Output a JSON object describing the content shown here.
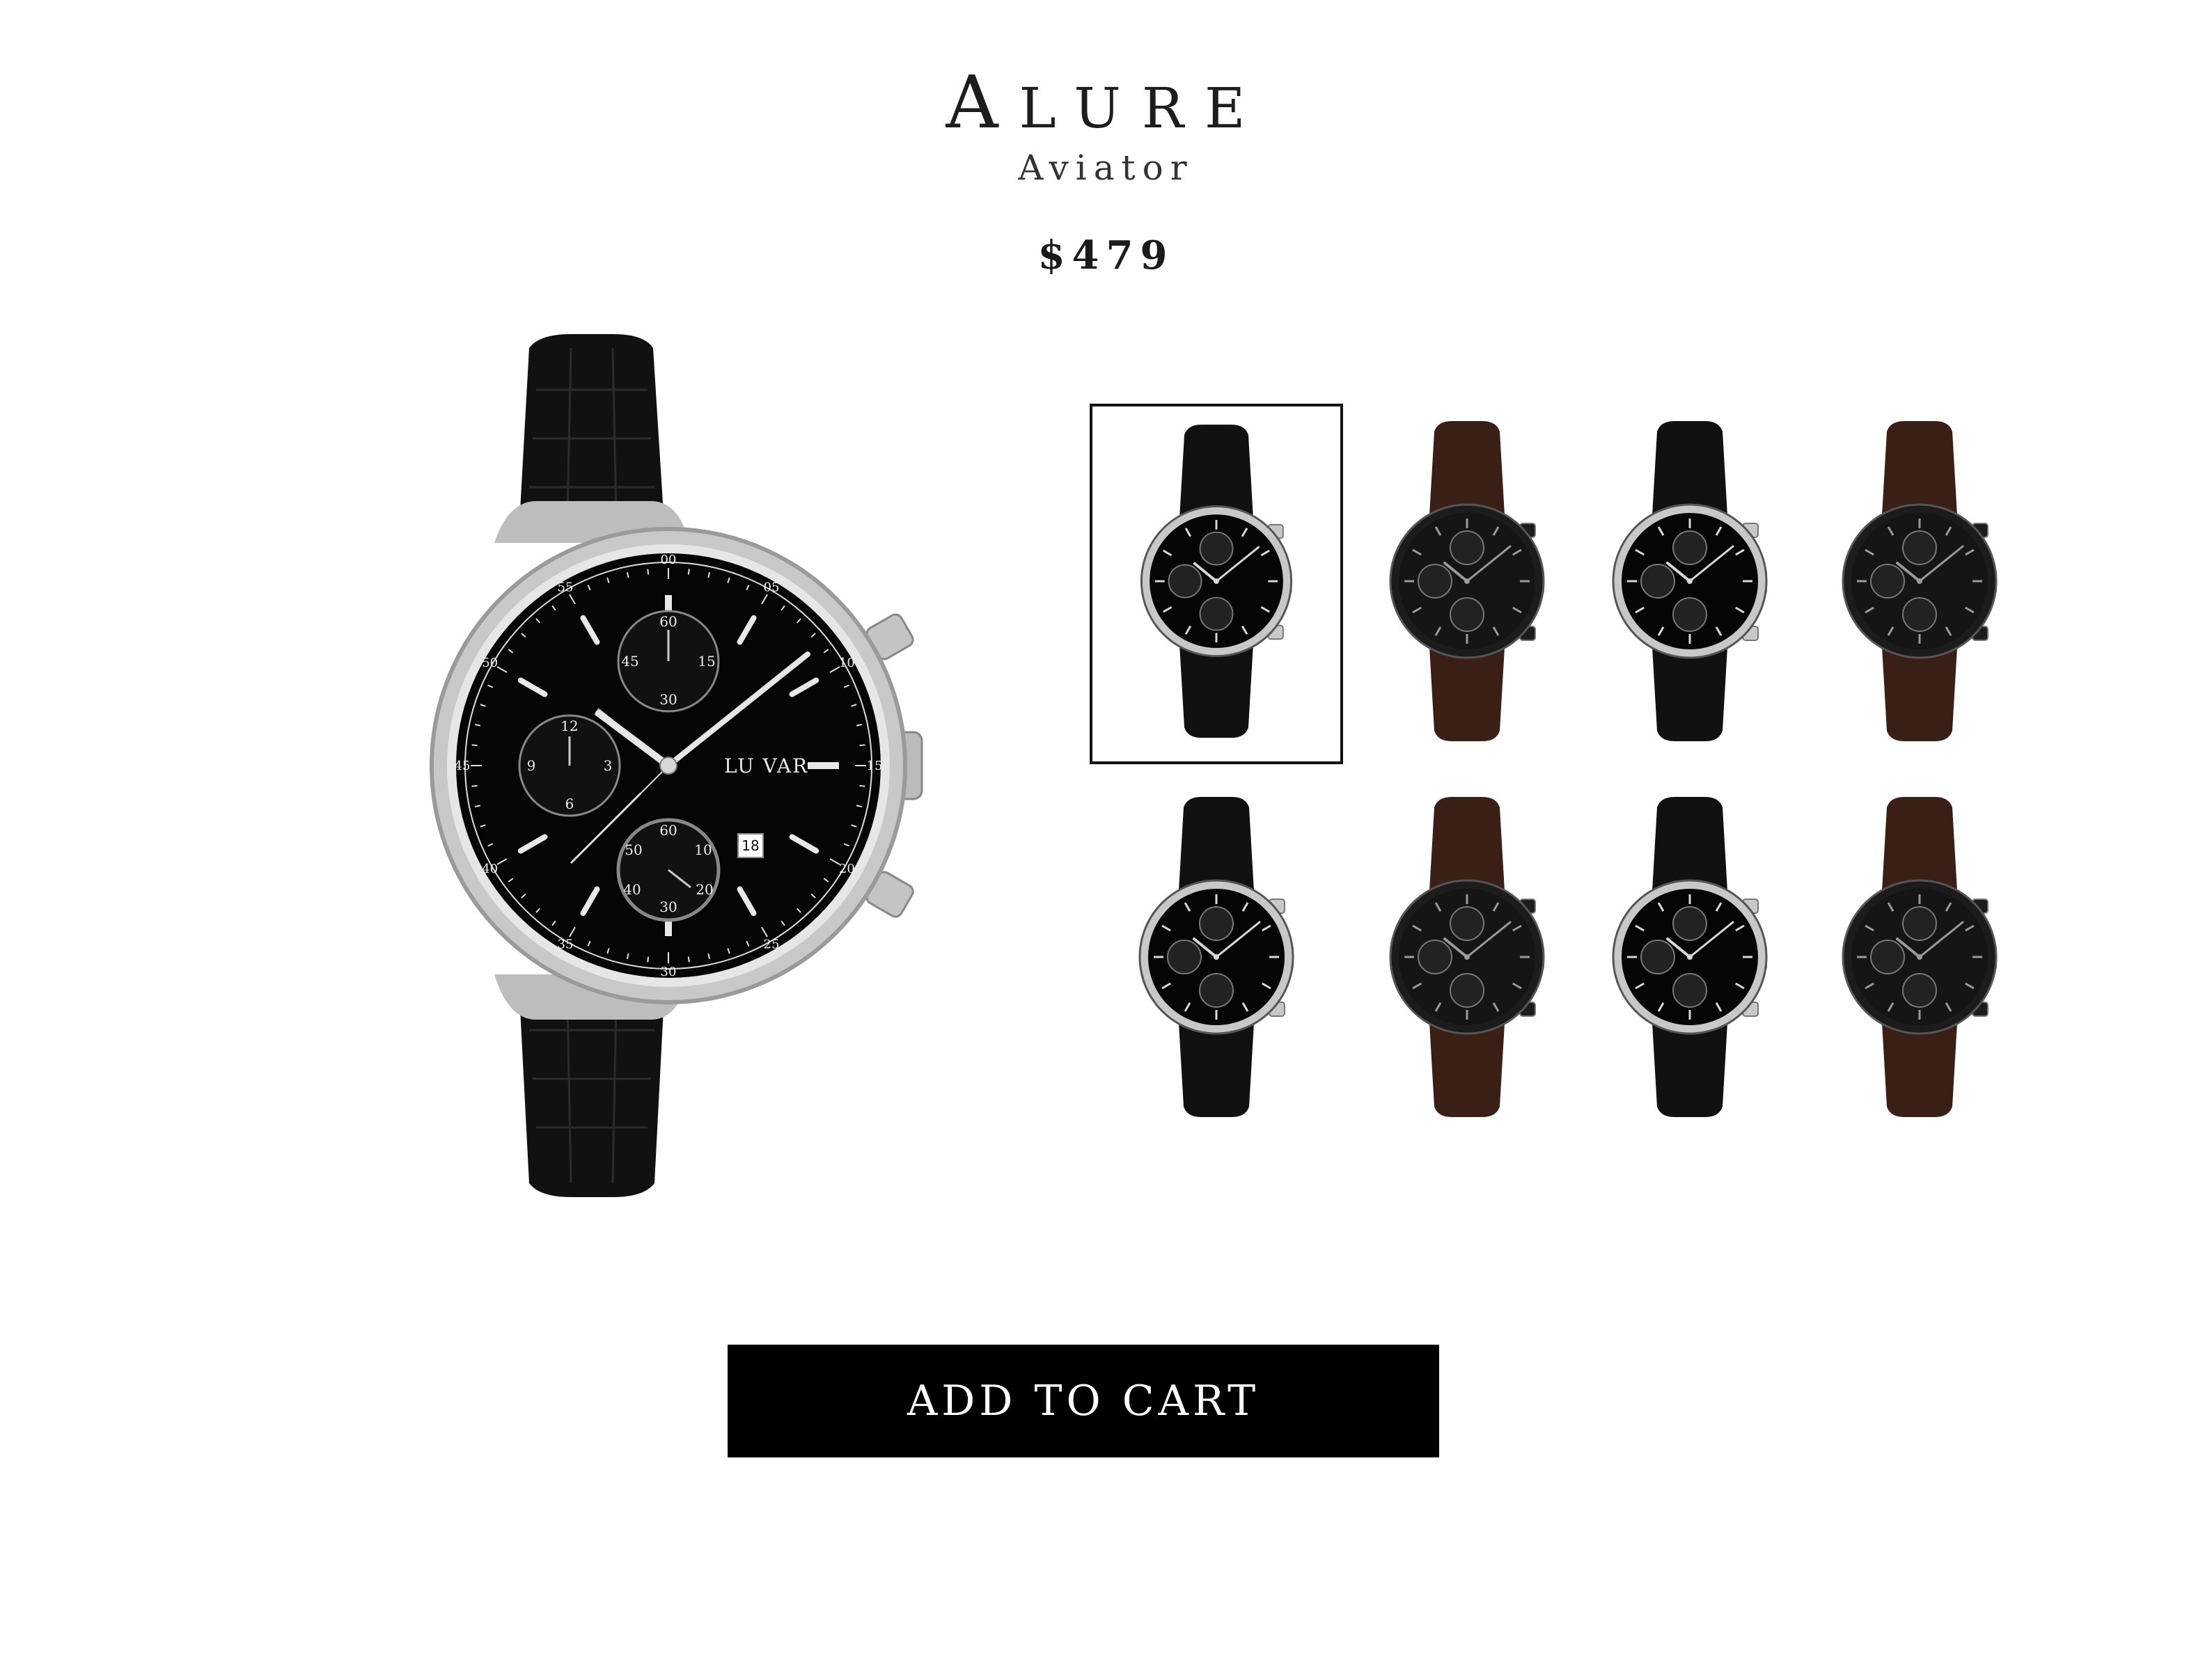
{
  "product": {
    "brand_first": "A",
    "brand_rest": "lure",
    "model": "Aviator",
    "price": "$479"
  },
  "main_image": {
    "dial_logo": "LU VAR",
    "strap_color": "#111111",
    "case_color": "#c8c8c8",
    "dial_color": "#050505",
    "minute_labels": [
      "00",
      "05",
      "10",
      "15",
      "20",
      "25",
      "30",
      "35",
      "40",
      "45",
      "50",
      "55"
    ],
    "top_subdial": [
      "60",
      "15",
      "30",
      "45"
    ],
    "left_subdial": [
      "12",
      "3",
      "6",
      "9"
    ],
    "bottom_subdial": [
      "60",
      "10",
      "20",
      "30",
      "40",
      "50"
    ],
    "date": "18"
  },
  "thumbnails": [
    {
      "variant": "silver-black",
      "selected": true
    },
    {
      "variant": "black-brown",
      "selected": false
    },
    {
      "variant": "silver-black",
      "selected": false
    },
    {
      "variant": "black-brown",
      "selected": false
    },
    {
      "variant": "silver-black",
      "selected": false
    },
    {
      "variant": "black-brown",
      "selected": false
    },
    {
      "variant": "silver-black",
      "selected": false
    },
    {
      "variant": "black-brown",
      "selected": false
    }
  ],
  "variants": {
    "silver-black": {
      "strap": "#111111",
      "case": "#c8c8c8",
      "dial": "#050505",
      "hands": "#d8d8d8"
    },
    "black-brown": {
      "strap": "#3a1f17",
      "case": "#1c1c1c",
      "dial": "#151515",
      "hands": "#9a9a9a"
    }
  },
  "actions": {
    "add_to_cart": "ADD TO CART"
  }
}
